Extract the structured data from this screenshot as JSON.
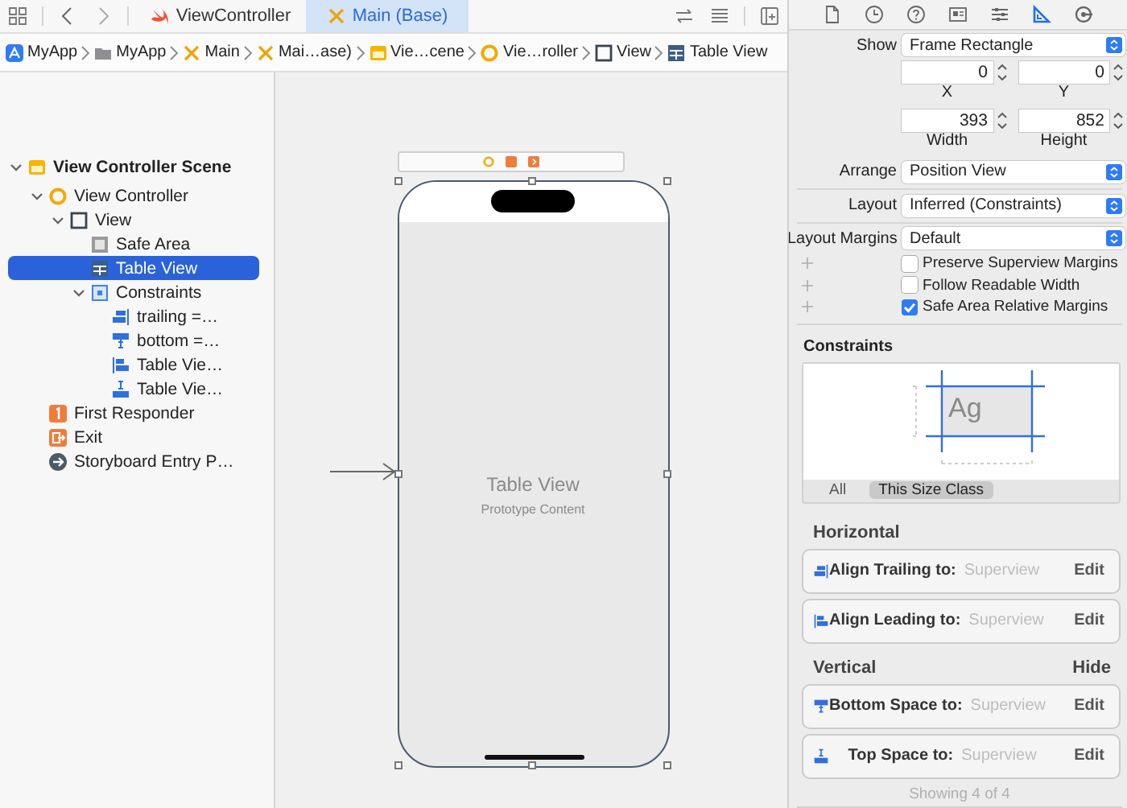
{
  "editor_tabs": [
    {
      "label": "ViewController",
      "kind": "swift",
      "selected": false
    },
    {
      "label": "Main (Base)",
      "kind": "storyboard",
      "selected": true
    }
  ],
  "breadcrumb": [
    {
      "label": "MyApp",
      "kind": "app"
    },
    {
      "label": "MyApp",
      "kind": "folder"
    },
    {
      "label": "Main",
      "kind": "storyboard"
    },
    {
      "label": "Mai…ase)",
      "kind": "storyboard"
    },
    {
      "label": "Vie…cene",
      "kind": "scene"
    },
    {
      "label": "Vie…roller",
      "kind": "view-controller"
    },
    {
      "label": "View",
      "kind": "view"
    },
    {
      "label": "Table View",
      "kind": "table"
    }
  ],
  "outline": [
    {
      "label": "View Controller Scene",
      "kind": "scene",
      "selected": false,
      "expanded": true,
      "children": [
        {
          "label": "View Controller",
          "kind": "view-controller",
          "selected": false,
          "expanded": true,
          "children": [
            {
              "label": "View",
              "kind": "view",
              "selected": false,
              "expanded": true,
              "children": [
                {
                  "label": "Safe Area",
                  "kind": "safe-area",
                  "selected": false
                },
                {
                  "label": "Table View",
                  "kind": "table",
                  "selected": true
                },
                {
                  "label": "Constraints",
                  "kind": "constraints",
                  "selected": false,
                  "expanded": true,
                  "children": [
                    {
                      "label": "trailing =…",
                      "kind": "align-trailing",
                      "selected": false
                    },
                    {
                      "label": "bottom =…",
                      "kind": "align-bottom",
                      "selected": false
                    },
                    {
                      "label": "Table Vie…",
                      "kind": "align-leading",
                      "selected": false
                    },
                    {
                      "label": "Table Vie…",
                      "kind": "align-top",
                      "selected": false
                    }
                  ]
                }
              ]
            }
          ]
        },
        {
          "label": "First Responder",
          "kind": "first-responder",
          "selected": false
        },
        {
          "label": "Exit",
          "kind": "exit",
          "selected": false
        },
        {
          "label": "Storyboard Entry P…",
          "kind": "entry",
          "selected": false
        }
      ]
    }
  ],
  "canvas": {
    "title": "Table View",
    "subtitle": "Prototype Content"
  },
  "inspector_tabs": [
    {
      "kind": "file",
      "selected": false
    },
    {
      "kind": "clock",
      "selected": false
    },
    {
      "kind": "help",
      "selected": false
    },
    {
      "kind": "identity",
      "selected": false
    },
    {
      "kind": "sliders",
      "selected": false
    },
    {
      "kind": "ruler",
      "selected": true
    },
    {
      "kind": "connections",
      "selected": false
    }
  ],
  "show": {
    "label": "Show",
    "value": "Frame Rectangle"
  },
  "frame": [
    [
      {
        "label": "X",
        "value": "0"
      },
      {
        "label": "Y",
        "value": "0"
      }
    ],
    [
      {
        "label": "Width",
        "value": "393"
      },
      {
        "label": "Height",
        "value": "852"
      }
    ]
  ],
  "popups": [
    {
      "label": "Arrange",
      "value": "Position View"
    },
    {
      "label": "Layout",
      "value": "Inferred (Constraints)"
    },
    {
      "label": "Layout Margins",
      "value": "Default"
    }
  ],
  "options": [
    {
      "label": "Preserve Superview Margins",
      "checked": false
    },
    {
      "label": "Follow Readable Width",
      "checked": false
    },
    {
      "label": "Safe Area Relative Margins",
      "checked": true
    }
  ],
  "constraints": {
    "title": "Constraints",
    "preview": "Ag",
    "filters": [
      {
        "label": "All",
        "selected": false
      },
      {
        "label": "This Size Class",
        "selected": true
      }
    ]
  },
  "groups": [
    {
      "title": "Horizontal",
      "rows": [
        {
          "kind": "align-trailing",
          "label": "Align Trailing to:",
          "target": "Superview",
          "action": "Edit"
        },
        {
          "kind": "align-leading",
          "label": "Align Leading to:",
          "target": "Superview",
          "action": "Edit"
        }
      ]
    },
    {
      "title": "Vertical",
      "action": "Hide",
      "rows": [
        {
          "kind": "align-bottom",
          "label": "Bottom Space to:",
          "target": "Superview",
          "action": "Edit"
        },
        {
          "kind": "align-top",
          "label": "Top Space to:",
          "target": "Superview",
          "action": "Edit"
        }
      ]
    }
  ],
  "footer": "Showing 4 of 4"
}
